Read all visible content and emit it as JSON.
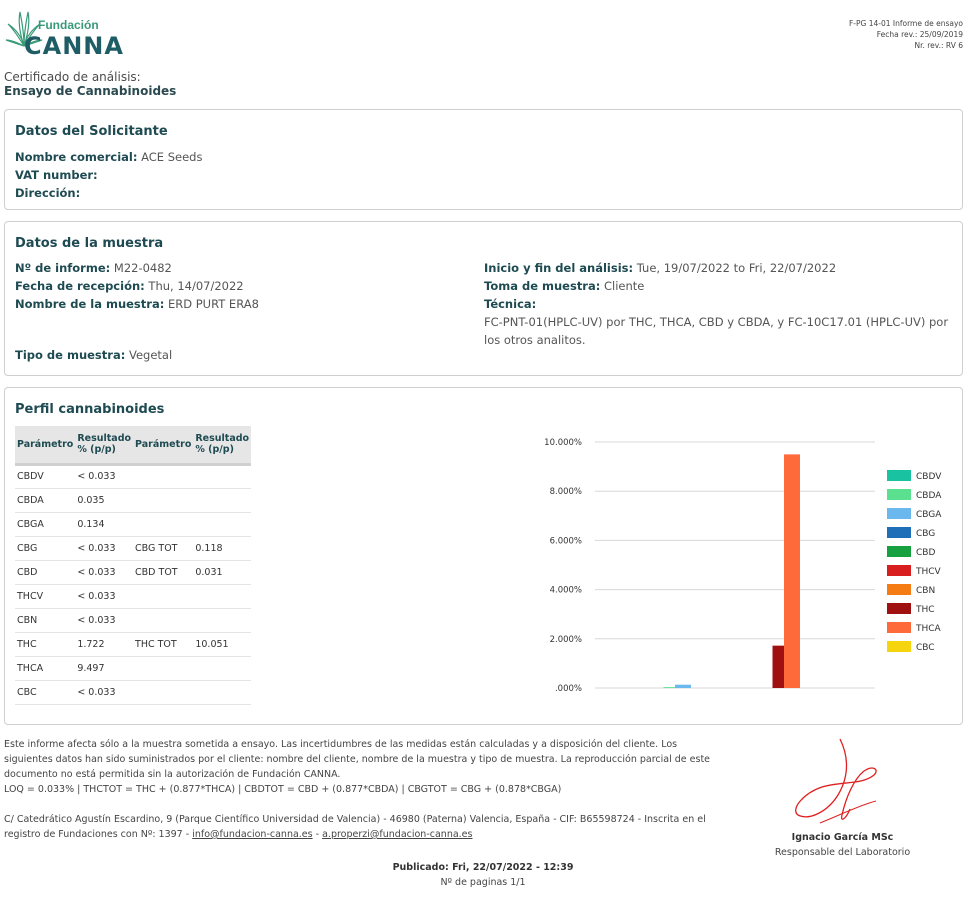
{
  "header": {
    "logo_small": "Fundación",
    "logo_big": "CANNA",
    "doc_code": "F-PG 14-01 Informe de ensayo",
    "rev_date": "Fecha rev.: 25/09/2019",
    "rev_num": "Nr. rev.: RV 6"
  },
  "cert": {
    "line1": "Certificado de análisis:",
    "line2": "Ensayo de Cannabinoides"
  },
  "applicant": {
    "title": "Datos del Solicitante",
    "name_label": "Nombre comercial:",
    "name_value": "ACE Seeds",
    "vat_label": "VAT number:",
    "address_label": "Dirección:"
  },
  "sample": {
    "title": "Datos de la muestra",
    "report_label": "Nº de informe:",
    "report_value": "M22-0482",
    "received_label": "Fecha de recepción:",
    "received_value": "Thu, 14/07/2022",
    "sample_name_label": "Nombre de la muestra:",
    "sample_name_value": "ERD PURT ERA8",
    "analysis_label": "Inicio y fin del análisis:",
    "analysis_value": "Tue, 19/07/2022 to Fri, 22/07/2022",
    "taken_label": "Toma de muestra:",
    "taken_value": "Cliente",
    "technique_label": "Técnica:",
    "technique_value": "FC-PNT-01(HPLC-UV) por THC, THCA, CBD y CBDA, y FC-10C17.01 (HPLC-UV) por los otros analitos.",
    "type_label": "Tipo de muestra:",
    "type_value": "Vegetal"
  },
  "profile": {
    "title": "Perfil cannabinoides",
    "headers": [
      "Parámetro",
      "Resultado % (p/p)",
      "Parámetro",
      "Resultado % (p/p)"
    ],
    "rows": [
      [
        "CBDV",
        "< 0.033",
        "",
        ""
      ],
      [
        "CBDA",
        "0.035",
        "",
        ""
      ],
      [
        "CBGA",
        "0.134",
        "",
        ""
      ],
      [
        "CBG",
        "< 0.033",
        "CBG TOT",
        "0.118"
      ],
      [
        "CBD",
        "< 0.033",
        "CBD TOT",
        "0.031"
      ],
      [
        "THCV",
        "< 0.033",
        "",
        ""
      ],
      [
        "CBN",
        "< 0.033",
        "",
        ""
      ],
      [
        "THC",
        "1.722",
        "THC TOT",
        "10.051"
      ],
      [
        "THCA",
        "9.497",
        "",
        ""
      ],
      [
        "CBC",
        "< 0.033",
        "",
        ""
      ]
    ]
  },
  "chart_data": {
    "type": "bar",
    "title": "",
    "xlabel": "",
    "ylabel": "",
    "ylim": [
      0,
      10
    ],
    "yticks": [
      ".000%",
      "2.000%",
      "4.000%",
      "6.000%",
      "8.000%",
      "10.000%"
    ],
    "grid": true,
    "legend_position": "right",
    "categories": [
      "CBDV",
      "CBDA",
      "CBGA",
      "CBG",
      "CBD",
      "THCV",
      "CBN",
      "THC",
      "THCA",
      "CBC"
    ],
    "values": [
      0,
      0.035,
      0.134,
      0,
      0,
      0,
      0,
      1.722,
      9.497,
      0
    ],
    "colors": [
      "#19c2a0",
      "#5ae08f",
      "#6ab8ee",
      "#1f6fb8",
      "#17a040",
      "#d81e1e",
      "#f57c14",
      "#a01010",
      "#ff6a3a",
      "#f6d40e"
    ]
  },
  "notes": {
    "line1": "Este informe afecta sólo a la muestra sometida a ensayo. Las incertidumbres de las medidas están calculadas y a disposición del cliente. Los",
    "line2": "siguientes datos han sido suministrados por el cliente: nombre del cliente, nombre de la muestra y tipo de muestra. La reproducción parcial de este",
    "line3": "documento no está permitida sin la autorización de Fundación CANNA.",
    "line4": "LOQ = 0.033% | THCTOT = THC + (0.877*THCA) | CBDTOT = CBD + (0.877*CBDA) | CBGTOT = CBG + (0.878*CBGA)"
  },
  "address": {
    "line1": "C/ Catedrático Agustín Escardino, 9 (Parque Científico Universidad de Valencia) - 46980 (Paterna) Valencia, España - CIF: B65598724 - Inscrita en el",
    "line2_prefix": "registro de Fundaciones con Nº: 1397 -",
    "email1": "info@fundacion-canna.es",
    "sep": "-",
    "email2": "a.properzi@fundacion-canna.es"
  },
  "signatory": {
    "name": "Ignacio García MSc",
    "role": "Responsable del Laboratorio"
  },
  "footer": {
    "published": "Publicado: Fri, 22/07/2022 - 12:39",
    "pages": "Nº de paginas 1/1"
  }
}
